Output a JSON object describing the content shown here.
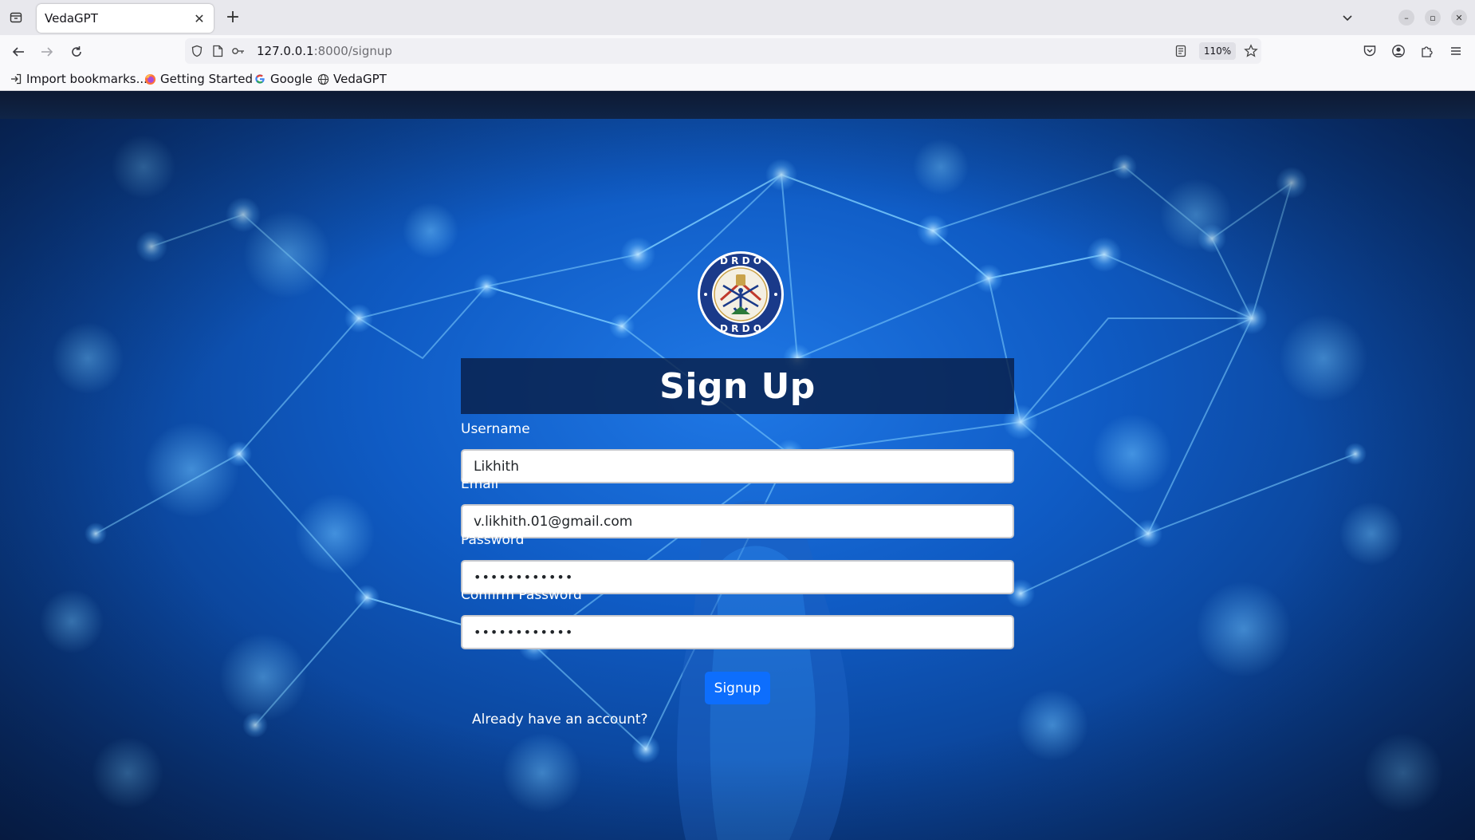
{
  "browser": {
    "tab_title": "VedaGPT",
    "url_host": "127.0.0.1",
    "url_path": ":8000/signup",
    "zoom": "110%",
    "bookmarks": [
      {
        "label": "Import bookmarks...",
        "icon": "import-icon"
      },
      {
        "label": "Getting Started",
        "icon": "firefox-icon"
      },
      {
        "label": "Google",
        "icon": "google-icon"
      },
      {
        "label": "VedaGPT",
        "icon": "globe-icon"
      }
    ]
  },
  "logo": {
    "top_text": "D R D O",
    "bottom_text": "D R D O"
  },
  "form": {
    "title": "Sign Up",
    "username_label": "Username",
    "username_value": "Likhith",
    "email_label": "Email",
    "email_value": "v.likhith.01@gmail.com",
    "password_label": "Password",
    "password_value": "••••••••••••",
    "confirm_label": "Confirm Password",
    "confirm_value": "••••••••••••",
    "submit_label": "Signup",
    "login_link": "Already have an account?"
  },
  "colors": {
    "accent": "#0d6efd",
    "title_bar": "#081e48",
    "background": "#0f5bc4"
  }
}
